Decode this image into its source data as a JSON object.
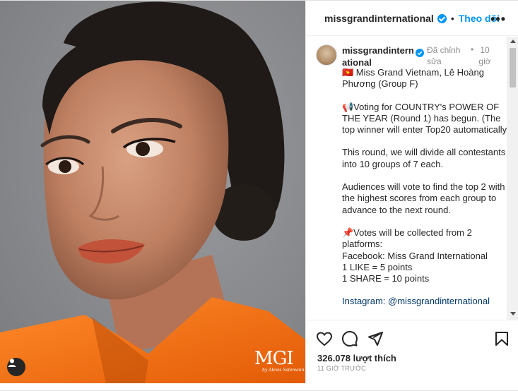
{
  "photo": {
    "watermark": "MGI",
    "watermark_sub": "by Alexis Salemann",
    "user_icon": "user-tag-icon"
  },
  "header": {
    "username": "missgrandinternational",
    "separator": "•",
    "follow_label": "Theo dõi",
    "more_icon": "more-horizontal-icon"
  },
  "post": {
    "author": "missgrandinternational",
    "edited": "Đã chỉnh sửa",
    "separator": "•",
    "ago": "10 giờ",
    "caption": [
      {
        "text": "🇻🇳 Miss Grand Vietnam, Lê Hoàng Phương (Group F)"
      },
      {
        "text": ""
      },
      {
        "text": "📢Voting for COUNTRY's POWER OF THE YEAR (Round 1) has begun. (The top winner will enter Top20 automatically)"
      },
      {
        "text": ""
      },
      {
        "text": "This round, we will divide all contestants into 10 groups of 7 each."
      },
      {
        "text": ""
      },
      {
        "text": "Audiences will vote to find the top 2 with the highest scores from each group to advance to the next round."
      },
      {
        "text": ""
      },
      {
        "text": "📌Votes will be collected from 2 platforms:"
      },
      {
        "text": "Facebook: Miss Grand International"
      },
      {
        "text": "1 LIKE = 5 points"
      },
      {
        "text": "1 SHARE = 10 points"
      },
      {
        "text": ""
      },
      {
        "text": "Instagram: @missgrandinternational"
      }
    ]
  },
  "actions": {
    "like_icon": "heart-icon",
    "comment_icon": "comment-icon",
    "share_icon": "send-icon",
    "save_icon": "bookmark-icon",
    "likes": "326.078 lượt thích",
    "time": "11 GIỜ TRƯỚC"
  },
  "colors": {
    "accent": "#0095f6",
    "muted": "#8e8e8e",
    "text": "#262626",
    "jacket": "#f26a12"
  }
}
